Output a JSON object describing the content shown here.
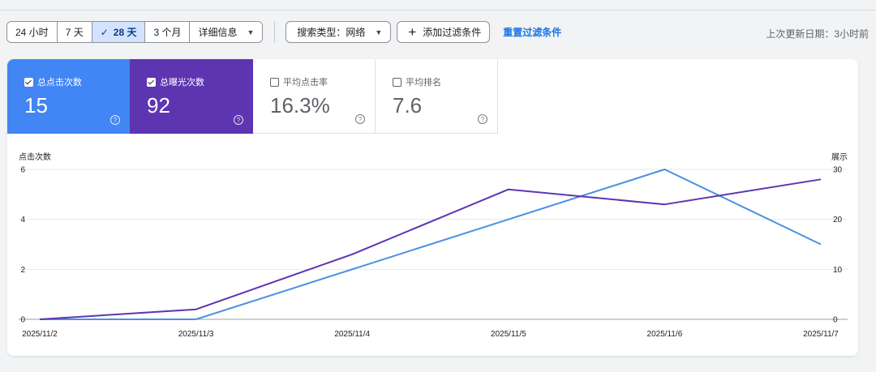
{
  "filters": {
    "ranges": [
      {
        "label": "24 小时",
        "active": false
      },
      {
        "label": "7 天",
        "active": false
      },
      {
        "label": "28 天",
        "active": true
      },
      {
        "label": "3 个月",
        "active": false
      },
      {
        "label": "详细信息",
        "active": false
      }
    ],
    "search_type": "搜索类型：网络",
    "add_filter": "添加过滤条件",
    "reset": "重置过滤条件",
    "last_updated": "上次更新日期：3小时前"
  },
  "metrics": [
    {
      "label": "总点击次数",
      "value": "15",
      "checked": true
    },
    {
      "label": "总曝光次数",
      "value": "92",
      "checked": true
    },
    {
      "label": "平均点击率",
      "value": "16.3%",
      "checked": false
    },
    {
      "label": "平均排名",
      "value": "7.6",
      "checked": false
    }
  ],
  "chart_data": {
    "type": "line",
    "x": [
      "2025/11/2",
      "2025/11/3",
      "2025/11/4",
      "2025/11/5",
      "2025/11/6",
      "2025/11/7"
    ],
    "series": [
      {
        "name": "点击次数",
        "axis": "left",
        "color": "#4a90e2",
        "values": [
          0,
          0,
          2,
          4,
          6,
          3
        ]
      },
      {
        "name": "展示",
        "axis": "right",
        "color": "#5e35b1",
        "values": [
          0,
          2,
          13,
          26,
          23,
          28
        ]
      }
    ],
    "left_axis": {
      "label": "点击次数",
      "ticks": [
        0,
        2,
        4,
        6
      ],
      "range": [
        0,
        6
      ]
    },
    "right_axis": {
      "label": "展示",
      "ticks": [
        0,
        10,
        20,
        30
      ],
      "range": [
        0,
        30
      ]
    },
    "grid": true
  }
}
